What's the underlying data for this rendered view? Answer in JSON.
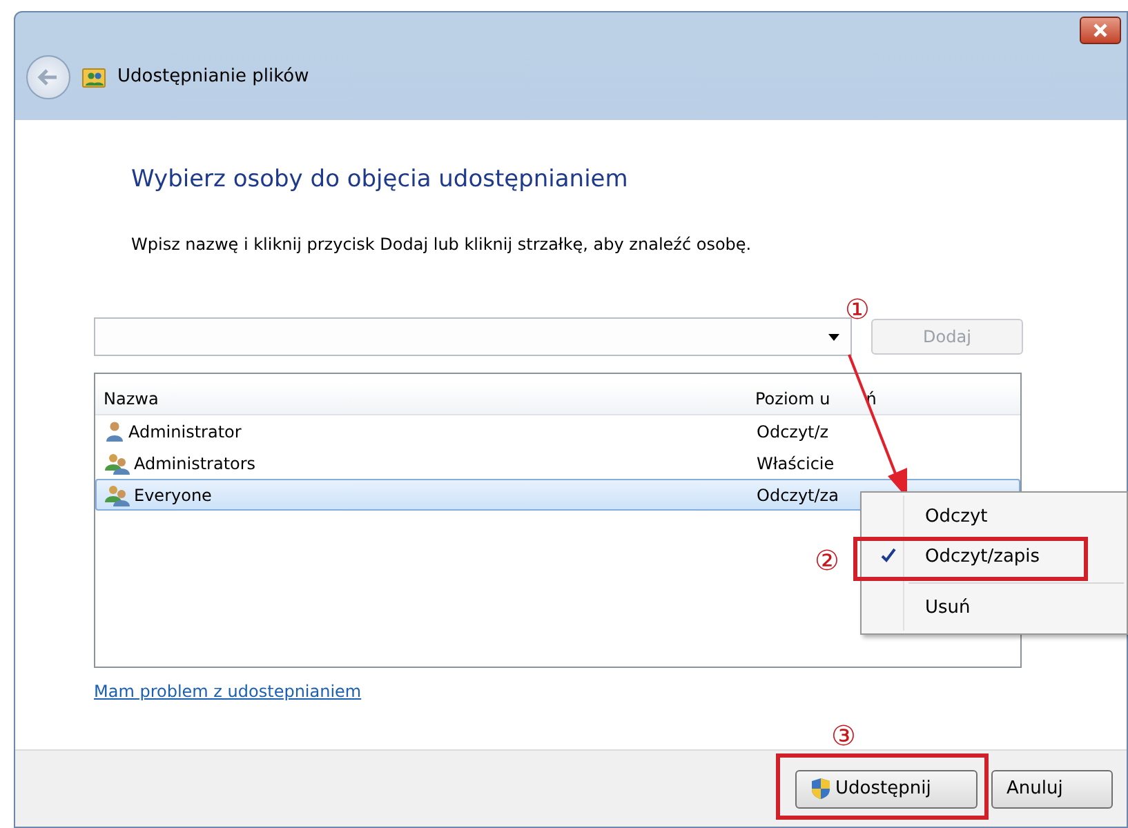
{
  "window": {
    "title": "Udostępnianie plików"
  },
  "heading": "Wybierz osoby do objęcia udostępnianiem",
  "instruction": "Wpisz nazwę i kliknij przycisk Dodaj lub kliknij strzałkę, aby znaleźć osobę.",
  "name_field": {
    "add_button": {
      "label": "Dodaj",
      "disabled": true
    }
  },
  "table": {
    "columns": [
      {
        "parts": [
          "Nazwa"
        ]
      },
      {
        "parts": [
          "Poziom u",
          "ń"
        ]
      }
    ],
    "rows": [
      {
        "name": "Administrator",
        "kind": "user",
        "level": "Odczyt/z",
        "selected": false
      },
      {
        "name": "Administrators",
        "kind": "group",
        "level": "Właścicie",
        "selected": false
      },
      {
        "name": "Everyone",
        "kind": "group",
        "level": "Odczyt/za",
        "selected": true
      }
    ]
  },
  "context_menu": {
    "items": [
      {
        "kind": "item",
        "label": "Odczyt",
        "checked": false
      },
      {
        "kind": "item",
        "label": "Odczyt/zapis",
        "checked": true
      },
      {
        "kind": "separator"
      },
      {
        "kind": "item",
        "label": "Usuń",
        "checked": false
      }
    ]
  },
  "help_link": "Mam problem z udostepnianiem",
  "buttons": [
    {
      "label": "Udostępnij",
      "kind": "shield"
    },
    {
      "label": "Anuluj",
      "kind": "plain"
    }
  ],
  "annotations": [
    "①",
    "②",
    "③"
  ]
}
